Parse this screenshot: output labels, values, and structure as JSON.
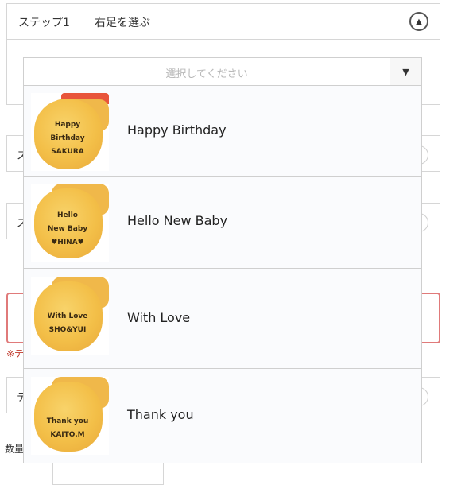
{
  "step1": {
    "label": "ステップ1",
    "text": "右足を選ぶ",
    "toggle_icon": "chevron-up-icon"
  },
  "select": {
    "placeholder": "選択してください",
    "arrow_icon": "caret-down-icon"
  },
  "options": [
    {
      "label": "Happy Birthday",
      "thumb_lines": [
        "Happy",
        "Birthday",
        "SAKURA"
      ]
    },
    {
      "label": "Hello New Baby",
      "thumb_lines": [
        "Hello",
        "New Baby",
        "♥HINA♥"
      ]
    },
    {
      "label": "With Love",
      "thumb_lines": [
        "With Love",
        "SHO&YUI"
      ]
    },
    {
      "label": "Thank you",
      "thumb_lines": [
        "Thank you",
        "KAITO.M"
      ]
    }
  ],
  "background": {
    "peek_chars": [
      "ス",
      "ス",
      "テ"
    ],
    "note": "※テ",
    "qty_label": "数量"
  },
  "colors": {
    "error_border": "#e07a7a",
    "note_red": "#c0392b",
    "thumb_yellow": "#f3bf48"
  }
}
